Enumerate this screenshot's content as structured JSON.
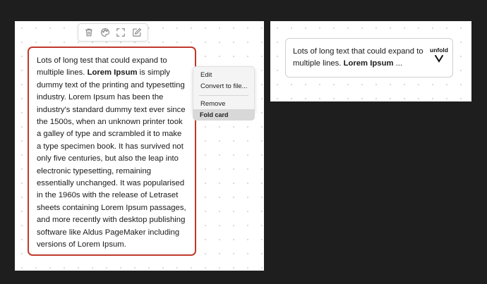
{
  "toolbar": {
    "icons": [
      "trash-icon",
      "palette-icon",
      "fullscreen-icon",
      "edit-icon"
    ]
  },
  "card": {
    "text_1": "Lots of long test that could expand to multiple lines. ",
    "bold": "Lorem Ipsum",
    "text_2": " is simply dummy text of the printing and typesetting industry. Lorem Ipsum has been the industry's standard dummy text ever since the 1500s, when an unknown printer took a galley of type and scrambled it to make a type specimen book. It has survived not only five centuries, but also the leap into electronic typesetting, remaining essentially unchanged. It was popularised in the 1960s with the release of Letraset sheets containing Lorem Ipsum passages, and more recently with desktop publishing software like Aldus PageMaker including versions of Lorem Ipsum.",
    "border_color": "#c0392b"
  },
  "context_menu": {
    "edit": "Edit",
    "convert": "Convert to file...",
    "remove": "Remove",
    "fold": "Fold card"
  },
  "folded_card": {
    "text_1": "Lots of long text that could expand to multiple lines. ",
    "bold": "Lorem Ipsum",
    "text_2": " ...",
    "unfold_label": "unfold"
  }
}
